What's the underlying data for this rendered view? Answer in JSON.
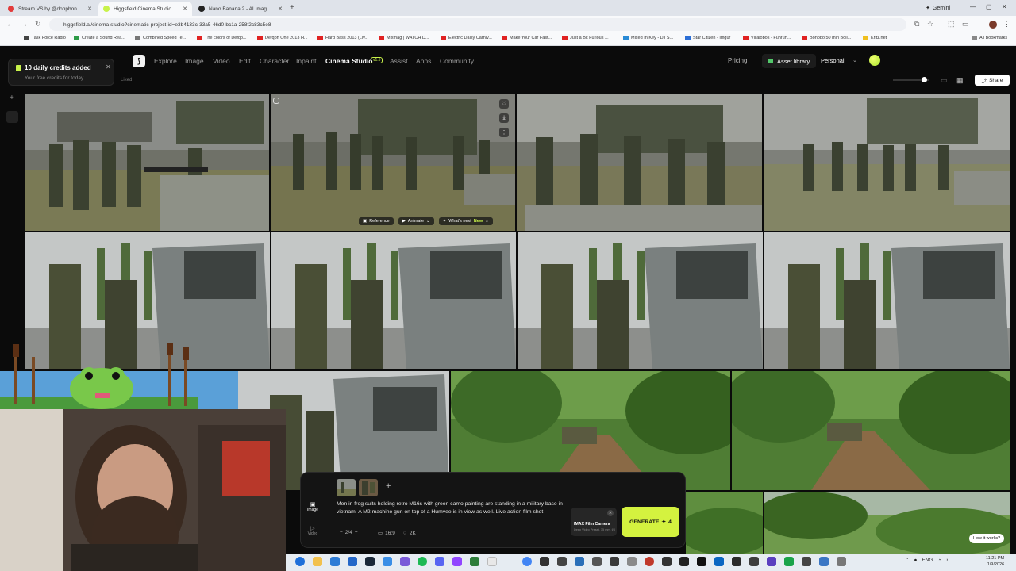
{
  "browser": {
    "tabs": [
      {
        "title": "Stream VS by @donpbongwat",
        "fav": "#e23b3b"
      },
      {
        "title": "Higgsfield Cinema Studio | Prof",
        "fav": "#c8f24a"
      },
      {
        "title": "Nano Banana 2 - AI Image Gen",
        "fav": "#222222"
      }
    ],
    "gemini_label": "Gemini",
    "url": "higgsfield.ai/cinema-studio?cinematic-project-id=e3b4133c-33a5-46d0-bc1a-258f2c83c5e8",
    "bookmarks": [
      {
        "label": "Task Force Radio",
        "color": "#444"
      },
      {
        "label": "Create a Sound Rea...",
        "color": "#2e9b48"
      },
      {
        "label": "Combined Speed Te...",
        "color": "#777"
      },
      {
        "label": "The colors of Defqo...",
        "color": "#e02222"
      },
      {
        "label": "Defqon One 2013 H...",
        "color": "#e02222"
      },
      {
        "label": "Hard Bass 2013 (Liv...",
        "color": "#e02222"
      },
      {
        "label": "Mixmag | WATCH D...",
        "color": "#e02222"
      },
      {
        "label": "Electric Daisy Carniv...",
        "color": "#e02222"
      },
      {
        "label": "Make Your Car Fast...",
        "color": "#e02222"
      },
      {
        "label": "Just a Bit Furious ...",
        "color": "#e02222"
      },
      {
        "label": "Mixed In Key - DJ S...",
        "color": "#2a8bd6"
      },
      {
        "label": "Star Citizen - Imgur",
        "color": "#2c6fd6"
      },
      {
        "label": "Villalobos - Fuhrun...",
        "color": "#e02222"
      },
      {
        "label": "Bonobo 50 min Boil...",
        "color": "#e02222"
      },
      {
        "label": "Kritz.net",
        "color": "#f0c020"
      }
    ],
    "all_bookmarks": "All Bookmarks"
  },
  "nav": {
    "items": [
      "Explore",
      "Image",
      "Video",
      "Edit",
      "Character",
      "Inpaint",
      "Cinema Studio",
      "Assist",
      "Apps",
      "Community"
    ],
    "current": "Cinema Studio",
    "badge": "v1.5",
    "pricing": "Pricing",
    "asset_library": "Asset library",
    "workspace": "Personal",
    "share": "Share"
  },
  "toast": {
    "title": "10 daily credits added",
    "subtitle": "Your free credits for today"
  },
  "liked_label": "Liked",
  "hover_actions": {
    "reference": "Reference",
    "animate": "Animate",
    "whats_next": "What's next",
    "new_badge": "New"
  },
  "composer": {
    "prompt": "Men in frog suits holding retro M16s with green camo painting are standing in a military base in vietnam. A M2 machine gun on top of a Humvee is in view as well. Live action film shot",
    "modes": [
      "Image",
      "Video"
    ],
    "count": "2/4",
    "aspect": "16:9",
    "resolution": "2K",
    "camera_name": "IMAX Film Camera",
    "camera_spec": "Deep Video Preset, 35 mm, f/4",
    "generate_label": "GENERATE",
    "generate_cost": "4",
    "how_it_works": "How it works?"
  },
  "taskbar": {
    "lang": "ENG",
    "time": "11:21 PM",
    "date": "1/9/2026"
  }
}
